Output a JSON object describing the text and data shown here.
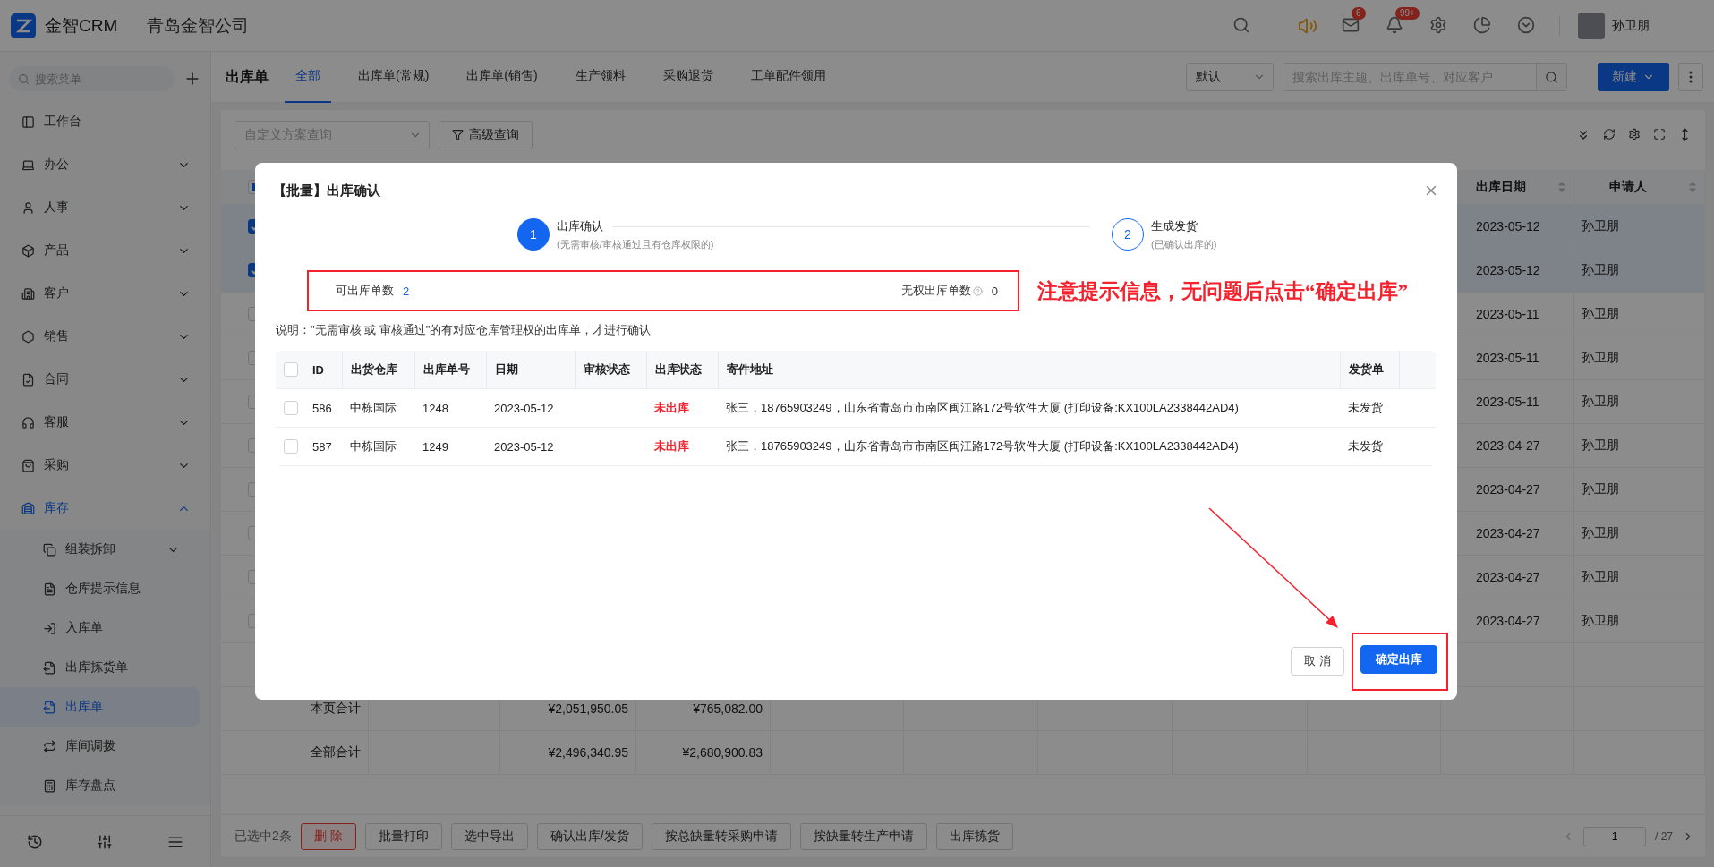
{
  "topbar": {
    "brand": "金智CRM",
    "company": "青岛金智公司",
    "mail_badge": "6",
    "bell_badge": "99+",
    "user": "孙卫朋"
  },
  "sidebar": {
    "search_placeholder": "搜索菜单",
    "items": [
      {
        "label": "工作台",
        "kind": "link",
        "selected": false
      },
      {
        "label": "办公",
        "kind": "group",
        "expanded": false,
        "selected": false
      },
      {
        "label": "人事",
        "kind": "group",
        "expanded": false,
        "selected": false
      },
      {
        "label": "产品",
        "kind": "group",
        "expanded": false,
        "selected": false
      },
      {
        "label": "客户",
        "kind": "group",
        "expanded": false,
        "selected": false
      },
      {
        "label": "销售",
        "kind": "group",
        "expanded": false,
        "selected": false
      },
      {
        "label": "合同",
        "kind": "group",
        "expanded": false,
        "selected": false
      },
      {
        "label": "客服",
        "kind": "group",
        "expanded": false,
        "selected": false
      },
      {
        "label": "采购",
        "kind": "group",
        "expanded": false,
        "selected": false
      },
      {
        "label": "库存",
        "kind": "group",
        "expanded": true,
        "selected": false,
        "children": [
          {
            "label": "组装拆卸",
            "kind": "group",
            "expanded": false,
            "selected": false
          },
          {
            "label": "仓库提示信息",
            "kind": "link",
            "selected": false
          },
          {
            "label": "入库单",
            "kind": "link",
            "selected": false
          },
          {
            "label": "出库拣货单",
            "kind": "link",
            "selected": false
          },
          {
            "label": "出库单",
            "kind": "link",
            "selected": true
          },
          {
            "label": "库间调拨",
            "kind": "link",
            "selected": false
          },
          {
            "label": "库存盘点",
            "kind": "link",
            "selected": false
          }
        ]
      }
    ]
  },
  "page": {
    "title": "出库单",
    "tabs": [
      {
        "label": "全部",
        "selected": true
      },
      {
        "label": "出库单(常规)",
        "selected": false
      },
      {
        "label": "出库单(销售)",
        "selected": false
      },
      {
        "label": "生产领料",
        "selected": false
      },
      {
        "label": "采购退货",
        "selected": false
      },
      {
        "label": "工单配件领用",
        "selected": false
      }
    ],
    "view_select": "默认",
    "search_placeholder": "搜索出库主题、出库单号、对应客户",
    "new_button": "新建",
    "scheme_placeholder": "自定义方案查询",
    "advanced_button": "高级查询"
  },
  "table": {
    "header_indeterminate": true,
    "columns": [
      {
        "label": "出库日期"
      },
      {
        "label": "申请人"
      }
    ],
    "rows": [
      {
        "checked": true,
        "date": "2023-05-12",
        "applicant": "孙卫朋"
      },
      {
        "checked": true,
        "date": "2023-05-12",
        "applicant": "孙卫朋"
      },
      {
        "checked": false,
        "date": "2023-05-11",
        "applicant": "孙卫朋"
      },
      {
        "checked": false,
        "date": "2023-05-11",
        "applicant": "孙卫朋"
      },
      {
        "checked": false,
        "date": "2023-05-11",
        "applicant": "孙卫朋"
      },
      {
        "checked": false,
        "date": "2023-04-27",
        "applicant": "孙卫朋"
      },
      {
        "checked": false,
        "date": "2023-04-27",
        "applicant": "孙卫朋"
      },
      {
        "checked": false,
        "date": "2023-04-27",
        "applicant": "孙卫朋"
      },
      {
        "checked": false,
        "date": "2023-04-27",
        "applicant": "孙卫朋"
      },
      {
        "checked": false,
        "date": "2023-04-27",
        "applicant": "孙卫朋"
      }
    ],
    "totals": [
      {
        "label": "本页合计",
        "amount_1": "¥2,051,950.05",
        "amount_2": "¥765,082.00"
      },
      {
        "label": "全部合计",
        "amount_1": "¥2,496,340.95",
        "amount_2": "¥2,680,900.83"
      }
    ]
  },
  "bottom_bar": {
    "selected_count": "已选中2条",
    "actions": [
      {
        "label": "删 除",
        "kind": "danger"
      },
      {
        "label": "批量打印",
        "kind": "default"
      },
      {
        "label": "选中导出",
        "kind": "default"
      },
      {
        "label": "确认出库/发货",
        "kind": "default"
      },
      {
        "label": "按总缺量转采购申请",
        "kind": "default"
      },
      {
        "label": "按缺量转生产申请",
        "kind": "default"
      },
      {
        "label": "出库拣货",
        "kind": "default"
      }
    ],
    "page": "1",
    "total": "/ 27"
  },
  "modal": {
    "title": "【批量】出库确认",
    "header_checked": false,
    "steps": [
      {
        "number": "1",
        "title": "出库确认",
        "description": "(无需审核/审核通过且有仓库权限的)",
        "active": true
      },
      {
        "number": "2",
        "title": "生成发货",
        "description": "(已确认出库的)",
        "active": false
      }
    ],
    "stats": {
      "available_label": "可出库单数",
      "available_value": "2",
      "denied_label": "无权出库单数",
      "denied_value": "0"
    },
    "annotation": "注意提示信息，无问题后点击“确定出库”",
    "note": "说明：\"无需审核 或 审核通过\"的有对应仓库管理权的出库单，才进行确认",
    "table": {
      "columns": [
        "ID",
        "出货仓库",
        "出库单号",
        "日期",
        "审核状态",
        "出库状态",
        "寄件地址",
        "发货单"
      ],
      "rows": [
        {
          "checked": false,
          "id": "586",
          "warehouse": "中栋国际",
          "number": "1248",
          "date": "2023-05-12",
          "status": "未出库",
          "address": "张三，18765903249，山东省青岛市市南区闽江路172号软件大厦 (打印设备:KX100LA2338442AD4)",
          "shipment": "未发货"
        },
        {
          "checked": false,
          "id": "587",
          "warehouse": "中栋国际",
          "number": "1249",
          "date": "2023-05-12",
          "status": "未出库",
          "address": "张三，18765903249，山东省青岛市市南区闽江路172号软件大厦 (打印设备:KX100LA2338442AD4)",
          "shipment": "未发货"
        }
      ]
    },
    "buttons": [
      {
        "label": "取 消",
        "kind": "default"
      },
      {
        "label": "确定出库",
        "kind": "primary"
      }
    ]
  }
}
